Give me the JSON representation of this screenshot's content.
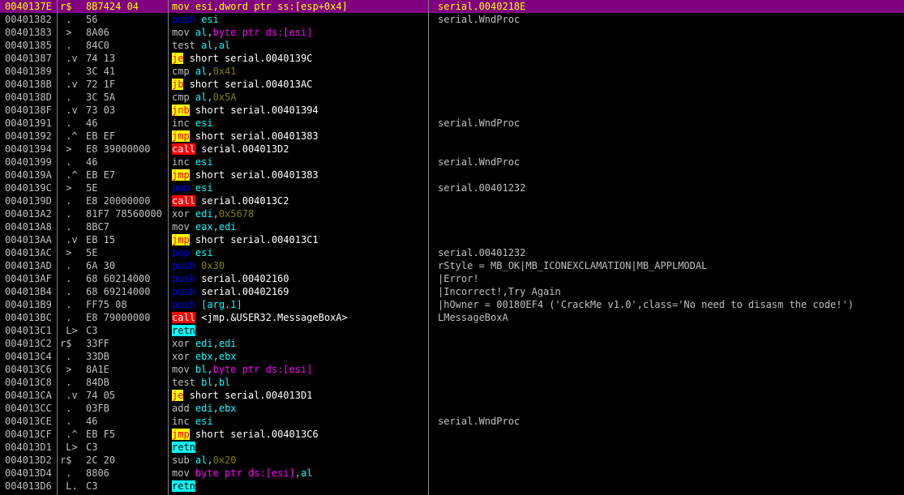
{
  "rows": [
    {
      "addr": "0040137E",
      "mark": "r$",
      "hex": "8B7424 04",
      "mn": "mov",
      "cls": "mn-def",
      "ops": [
        [
          "esi",
          "op-reg"
        ],
        [
          ",",
          ""
        ],
        [
          "dword ptr ss:[esp+0x4]",
          "op-mem"
        ]
      ],
      "cmt": "serial.0040218E",
      "sel": true
    },
    {
      "addr": "00401382",
      "mark": " .",
      "hex": "56",
      "mn": "push",
      "cls": "mn-stack",
      "ops": [
        [
          "esi",
          "op-reg"
        ]
      ],
      "cmt": "serial.WndProc"
    },
    {
      "addr": "00401383",
      "mark": " >",
      "hex": "8A06",
      "mn": "mov",
      "cls": "mn-def",
      "ops": [
        [
          "al",
          "op-reg"
        ],
        [
          ",",
          ""
        ],
        [
          "byte ptr ds:[esi]",
          "op-mem"
        ]
      ],
      "cmt": ""
    },
    {
      "addr": "00401385",
      "mark": " .",
      "hex": "84C0",
      "mn": "test",
      "cls": "mn-def",
      "ops": [
        [
          "al",
          "op-reg"
        ],
        [
          ",",
          ""
        ],
        [
          "al",
          "op-reg"
        ]
      ],
      "cmt": ""
    },
    {
      "addr": "00401387",
      "mark": " .v",
      "hex": "74 13",
      "mn": "je",
      "cls": "mn-cond",
      "ops": [
        [
          "short serial.0040139C",
          "op-lbl"
        ]
      ],
      "cmt": ""
    },
    {
      "addr": "00401389",
      "mark": " .",
      "hex": "3C 41",
      "mn": "cmp",
      "cls": "mn-def",
      "ops": [
        [
          "al",
          "op-reg"
        ],
        [
          ",",
          ""
        ],
        [
          "0x41",
          "op-imm"
        ]
      ],
      "cmt": ""
    },
    {
      "addr": "0040138B",
      "mark": " .v",
      "hex": "72 1F",
      "mn": "jb",
      "cls": "mn-cond",
      "ops": [
        [
          "short serial.004013AC",
          "op-lbl"
        ]
      ],
      "cmt": ""
    },
    {
      "addr": "0040138D",
      "mark": " .",
      "hex": "3C 5A",
      "mn": "cmp",
      "cls": "mn-def",
      "ops": [
        [
          "al",
          "op-reg"
        ],
        [
          ",",
          ""
        ],
        [
          "0x5A",
          "op-imm"
        ]
      ],
      "cmt": ""
    },
    {
      "addr": "0040138F",
      "mark": " .v",
      "hex": "73 03",
      "mn": "jnb",
      "cls": "mn-cond",
      "ops": [
        [
          "short serial.00401394",
          "op-lbl"
        ]
      ],
      "cmt": ""
    },
    {
      "addr": "00401391",
      "mark": " .",
      "hex": "46",
      "mn": "inc",
      "cls": "mn-def",
      "ops": [
        [
          "esi",
          "op-reg"
        ]
      ],
      "cmt": "serial.WndProc"
    },
    {
      "addr": "00401392",
      "mark": " .^",
      "hex": "EB EF",
      "mn": "jmp",
      "cls": "mn-jmp",
      "ops": [
        [
          "short serial.00401383",
          "op-lbl"
        ]
      ],
      "cmt": ""
    },
    {
      "addr": "00401394",
      "mark": " >",
      "hex": "E8 39000000",
      "mn": "call",
      "cls": "mn-call",
      "ops": [
        [
          "serial.004013D2",
          "op-lbl"
        ]
      ],
      "cmt": ""
    },
    {
      "addr": "00401399",
      "mark": " .",
      "hex": "46",
      "mn": "inc",
      "cls": "mn-def",
      "ops": [
        [
          "esi",
          "op-reg"
        ]
      ],
      "cmt": "serial.WndProc"
    },
    {
      "addr": "0040139A",
      "mark": " .^",
      "hex": "EB E7",
      "mn": "jmp",
      "cls": "mn-jmp",
      "ops": [
        [
          "short serial.00401383",
          "op-lbl"
        ]
      ],
      "cmt": ""
    },
    {
      "addr": "0040139C",
      "mark": " >",
      "hex": "5E",
      "mn": "pop",
      "cls": "mn-stack",
      "ops": [
        [
          "esi",
          "op-reg"
        ]
      ],
      "cmt": "serial.00401232"
    },
    {
      "addr": "0040139D",
      "mark": " .",
      "hex": "E8 20000000",
      "mn": "call",
      "cls": "mn-call",
      "ops": [
        [
          "serial.004013C2",
          "op-lbl"
        ]
      ],
      "cmt": ""
    },
    {
      "addr": "004013A2",
      "mark": " .",
      "hex": "81F7 78560000",
      "mn": "xor",
      "cls": "mn-def",
      "ops": [
        [
          "edi",
          "op-reg"
        ],
        [
          ",",
          ""
        ],
        [
          "0x5678",
          "op-imm"
        ]
      ],
      "cmt": ""
    },
    {
      "addr": "004013A8",
      "mark": " .",
      "hex": "8BC7",
      "mn": "mov",
      "cls": "mn-def",
      "ops": [
        [
          "eax",
          "op-reg"
        ],
        [
          ",",
          ""
        ],
        [
          "edi",
          "op-reg"
        ]
      ],
      "cmt": ""
    },
    {
      "addr": "004013AA",
      "mark": " .v",
      "hex": "EB 15",
      "mn": "jmp",
      "cls": "mn-jmp",
      "ops": [
        [
          "short serial.004013C1",
          "op-lbl"
        ]
      ],
      "cmt": ""
    },
    {
      "addr": "004013AC",
      "mark": " >",
      "hex": "5E",
      "mn": "pop",
      "cls": "mn-stack",
      "ops": [
        [
          "esi",
          "op-reg"
        ]
      ],
      "cmt": "serial.00401232"
    },
    {
      "addr": "004013AD",
      "mark": " .",
      "hex": "6A 30",
      "mn": "push",
      "cls": "mn-stack",
      "ops": [
        [
          "0x30",
          "op-imm"
        ]
      ],
      "cmt": "rStyle = MB_OK|MB_ICONEXCLAMATION|MB_APPLMODAL"
    },
    {
      "addr": "004013AF",
      "mark": " .",
      "hex": "68 60214000",
      "mn": "push",
      "cls": "mn-stack",
      "ops": [
        [
          "serial.00402160",
          "op-lbl"
        ]
      ],
      "cmt": "|Error!"
    },
    {
      "addr": "004013B4",
      "mark": " .",
      "hex": "68 69214000",
      "mn": "push",
      "cls": "mn-stack",
      "ops": [
        [
          "serial.00402169",
          "op-lbl"
        ]
      ],
      "cmt": "|Incorrect!,Try Again"
    },
    {
      "addr": "004013B9",
      "mark": " .",
      "hex": "FF75 08",
      "mn": "push",
      "cls": "mn-stack",
      "ops": [
        [
          "[arg.1]",
          "op-reg"
        ]
      ],
      "cmt": "|hOwner = 00180EF4 ('CrackMe v1.0',class='No need to disasm the code!')"
    },
    {
      "addr": "004013BC",
      "mark": " .",
      "hex": "E8 79000000",
      "mn": "call",
      "cls": "mn-call",
      "ops": [
        [
          "<jmp.&USER32.MessageBoxA>",
          "op-lbl"
        ]
      ],
      "cmt": "LMessageBoxA",
      "cmtRed": true
    },
    {
      "addr": "004013C1",
      "mark": " L>",
      "hex": "C3",
      "mn": "retn",
      "cls": "mn-ret",
      "ops": [],
      "cmt": ""
    },
    {
      "addr": "004013C2",
      "mark": "r$",
      "hex": "33FF",
      "mn": "xor",
      "cls": "mn-def",
      "ops": [
        [
          "edi",
          "op-reg"
        ],
        [
          ",",
          ""
        ],
        [
          "edi",
          "op-reg"
        ]
      ],
      "cmt": ""
    },
    {
      "addr": "004013C4",
      "mark": " .",
      "hex": "33DB",
      "mn": "xor",
      "cls": "mn-def",
      "ops": [
        [
          "ebx",
          "op-reg"
        ],
        [
          ",",
          ""
        ],
        [
          "ebx",
          "op-reg"
        ]
      ],
      "cmt": ""
    },
    {
      "addr": "004013C6",
      "mark": " >",
      "hex": "8A1E",
      "mn": "mov",
      "cls": "mn-def",
      "ops": [
        [
          "bl",
          "op-reg"
        ],
        [
          ",",
          ""
        ],
        [
          "byte ptr ds:[esi]",
          "op-mem"
        ]
      ],
      "cmt": ""
    },
    {
      "addr": "004013C8",
      "mark": " .",
      "hex": "84DB",
      "mn": "test",
      "cls": "mn-def",
      "ops": [
        [
          "bl",
          "op-reg"
        ],
        [
          ",",
          ""
        ],
        [
          "bl",
          "op-reg"
        ]
      ],
      "cmt": ""
    },
    {
      "addr": "004013CA",
      "mark": " .v",
      "hex": "74 05",
      "mn": "je",
      "cls": "mn-cond",
      "ops": [
        [
          "short serial.004013D1",
          "op-lbl"
        ]
      ],
      "cmt": ""
    },
    {
      "addr": "004013CC",
      "mark": " .",
      "hex": "03FB",
      "mn": "add",
      "cls": "mn-def",
      "ops": [
        [
          "edi",
          "op-reg"
        ],
        [
          ",",
          ""
        ],
        [
          "ebx",
          "op-reg"
        ]
      ],
      "cmt": ""
    },
    {
      "addr": "004013CE",
      "mark": " .",
      "hex": "46",
      "mn": "inc",
      "cls": "mn-def",
      "ops": [
        [
          "esi",
          "op-reg"
        ]
      ],
      "cmt": "serial.WndProc"
    },
    {
      "addr": "004013CF",
      "mark": " .^",
      "hex": "EB F5",
      "mn": "jmp",
      "cls": "mn-jmp",
      "ops": [
        [
          "short serial.004013C6",
          "op-lbl"
        ]
      ],
      "cmt": ""
    },
    {
      "addr": "004013D1",
      "mark": " L>",
      "hex": "C3",
      "mn": "retn",
      "cls": "mn-ret",
      "ops": [],
      "cmt": ""
    },
    {
      "addr": "004013D2",
      "mark": "r$",
      "hex": "2C 20",
      "mn": "sub",
      "cls": "mn-def",
      "ops": [
        [
          "al",
          "op-reg"
        ],
        [
          ",",
          ""
        ],
        [
          "0x20",
          "op-imm"
        ]
      ],
      "cmt": ""
    },
    {
      "addr": "004013D4",
      "mark": " .",
      "hex": "8806",
      "mn": "mov",
      "cls": "mn-def",
      "ops": [
        [
          "byte ptr ds:[esi]",
          "op-mem"
        ],
        [
          ",",
          ""
        ],
        [
          "al",
          "op-reg"
        ]
      ],
      "cmt": ""
    },
    {
      "addr": "004013D6",
      "mark": " L.",
      "hex": "C3",
      "mn": "retn",
      "cls": "mn-ret",
      "ops": [],
      "cmt": ""
    }
  ],
  "colors": {
    "background": "#000000",
    "selection": "#800080",
    "gray": "#c0c0c0"
  }
}
